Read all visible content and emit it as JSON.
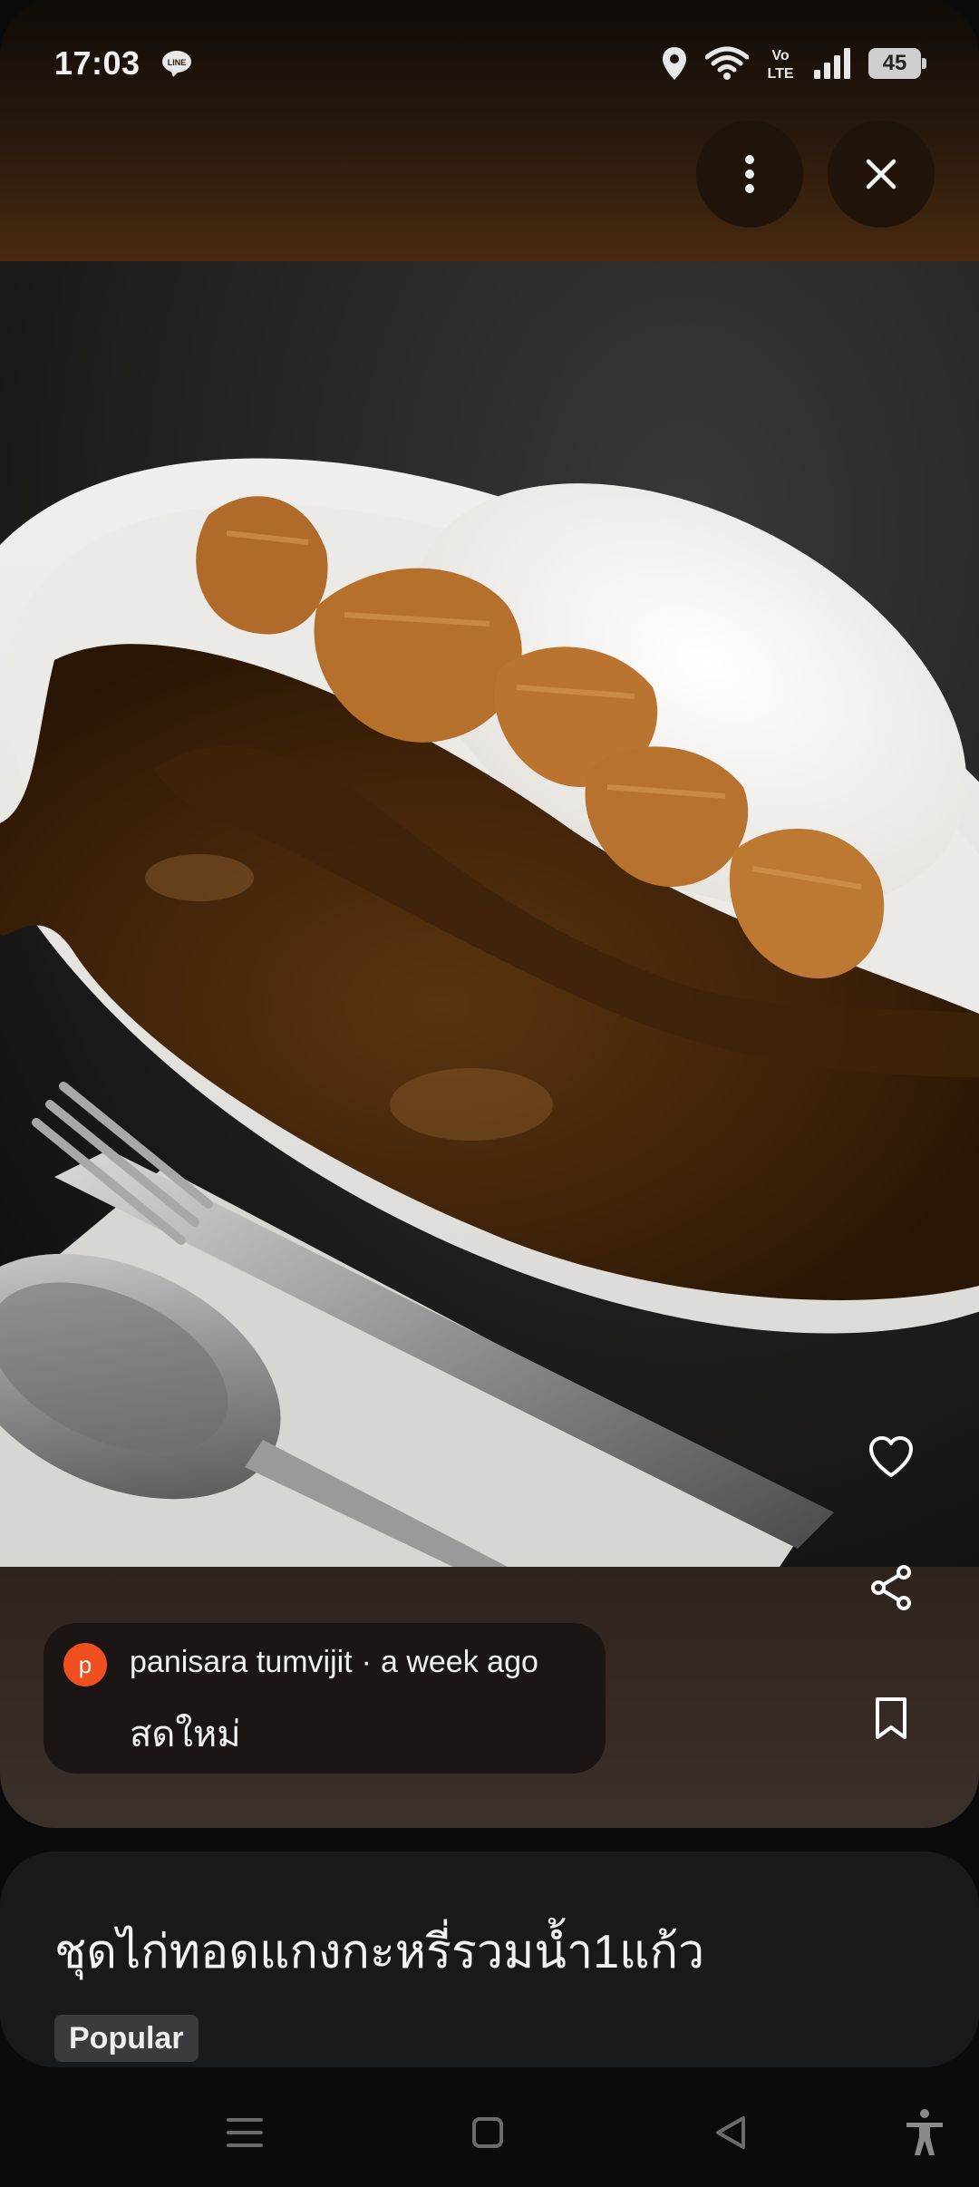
{
  "status_bar": {
    "time": "17:03",
    "battery_level": "45",
    "icons": [
      "line-app-icon",
      "location-icon",
      "wifi-icon",
      "volte-icon",
      "signal-icon",
      "battery-icon"
    ]
  },
  "top_actions": {
    "more_icon": "more-vertical-icon",
    "close_icon": "close-icon"
  },
  "photo": {
    "alt_icon": "photo"
  },
  "actions": {
    "like_icon": "heart-icon",
    "share_icon": "share-icon",
    "save_icon": "bookmark-icon"
  },
  "review": {
    "avatar_letter": "p",
    "author": "panisara tumvijit",
    "separator": "·",
    "time_ago": "a week ago",
    "text": "สดใหม่"
  },
  "place": {
    "title": "ชุดไก่ทอดแกงกะหรี่รวมน้ำ1แก้ว",
    "badge": "Popular"
  },
  "colors": {
    "avatar": "#f05020",
    "header_brown": "#4a2a10",
    "card_bg": "#17191b"
  }
}
